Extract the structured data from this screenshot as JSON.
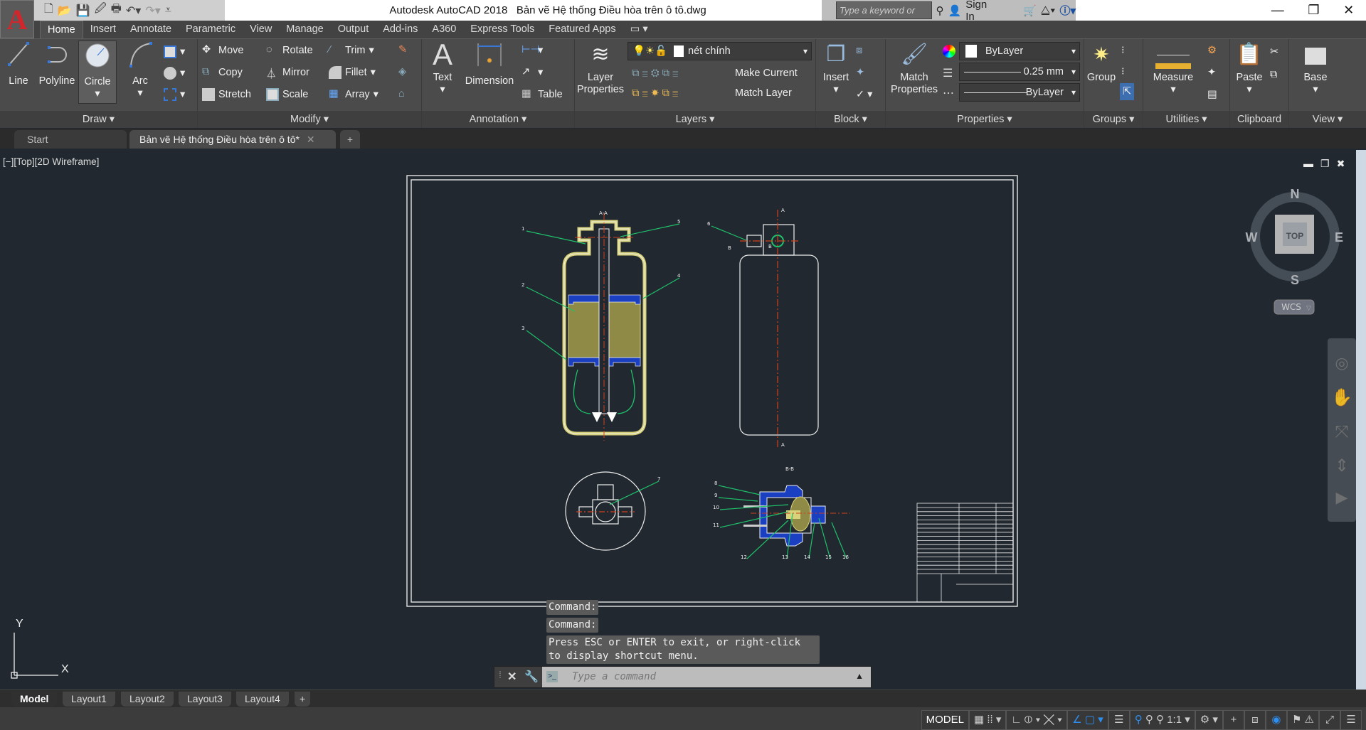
{
  "app": {
    "logo_letter": "A",
    "title": "Autodesk AutoCAD 2018",
    "filename": "Bản vẽ Hệ thống Điều hòa trên ô tô.dwg"
  },
  "search": {
    "placeholder": "Type a keyword or phrase",
    "sign_in": "Sign In"
  },
  "ribbon_tabs": [
    "Home",
    "Insert",
    "Annotate",
    "Parametric",
    "View",
    "Manage",
    "Output",
    "Add-ins",
    "A360",
    "Express Tools",
    "Featured Apps"
  ],
  "draw": {
    "label": "Draw ▾",
    "line": "Line",
    "polyline": "Polyline",
    "circle": "Circle",
    "arc": "Arc"
  },
  "modify": {
    "label": "Modify ▾",
    "move": "Move",
    "rotate": "Rotate",
    "trim": "Trim",
    "copy": "Copy",
    "mirror": "Mirror",
    "fillet": "Fillet",
    "stretch": "Stretch",
    "scale": "Scale",
    "array": "Array"
  },
  "annotation": {
    "label": "Annotation ▾",
    "text": "Text",
    "dimension": "Dimension",
    "table": "Table"
  },
  "layers": {
    "label": "Layers ▾",
    "properties_l1": "Layer",
    "properties_l2": "Properties",
    "current_layer": "nét chính",
    "make_current": "Make Current",
    "match_layer": "Match Layer"
  },
  "block": {
    "label": "Block ▾",
    "insert": "Insert"
  },
  "properties": {
    "label": "Properties ▾",
    "match_l1": "Match",
    "match_l2": "Properties",
    "color": "ByLayer",
    "lineweight": "0.25 mm",
    "linetype": "ByLayer"
  },
  "groups": {
    "label": "Groups ▾",
    "group": "Group"
  },
  "utilities": {
    "label": "Utilities ▾",
    "measure": "Measure"
  },
  "clipboard": {
    "label": "Clipboard",
    "paste": "Paste"
  },
  "view": {
    "label": "View ▾",
    "base": "Base"
  },
  "doc_tabs": {
    "start": "Start",
    "active": "Bản vẽ Hệ thống Điều hòa trên ô tô*"
  },
  "viewport": {
    "label": "[−][Top][2D Wireframe]"
  },
  "viewcube": {
    "n": "N",
    "s": "S",
    "e": "E",
    "w": "W",
    "face": "TOP",
    "ucs": "WCS"
  },
  "ucs_icon": {
    "x": "X",
    "y": "Y"
  },
  "drawing": {
    "section_aa": "A-A",
    "section_bb": "B-B",
    "cut_a": "A",
    "cut_b": "B",
    "part_numbers": [
      "1",
      "2",
      "3",
      "4",
      "5",
      "6",
      "7",
      "8",
      "9",
      "10",
      "11",
      "12",
      "13",
      "14",
      "15",
      "16"
    ]
  },
  "command": {
    "history": [
      "Command:",
      "Command:",
      "Press ESC or ENTER to exit, or right-click to display shortcut menu."
    ],
    "placeholder": "Type a command"
  },
  "layout_tabs": [
    "Model",
    "Layout1",
    "Layout2",
    "Layout3",
    "Layout4"
  ],
  "status": {
    "model": "MODEL",
    "scale": "1:1"
  },
  "colors": {
    "viewport_bg": "#212830",
    "accent": "#2e8ef0",
    "center_line": "#d0401a",
    "leader": "#1fc16b",
    "hatch_blue": "#1a3fc0",
    "filter_yellow": "#d8d27a"
  }
}
